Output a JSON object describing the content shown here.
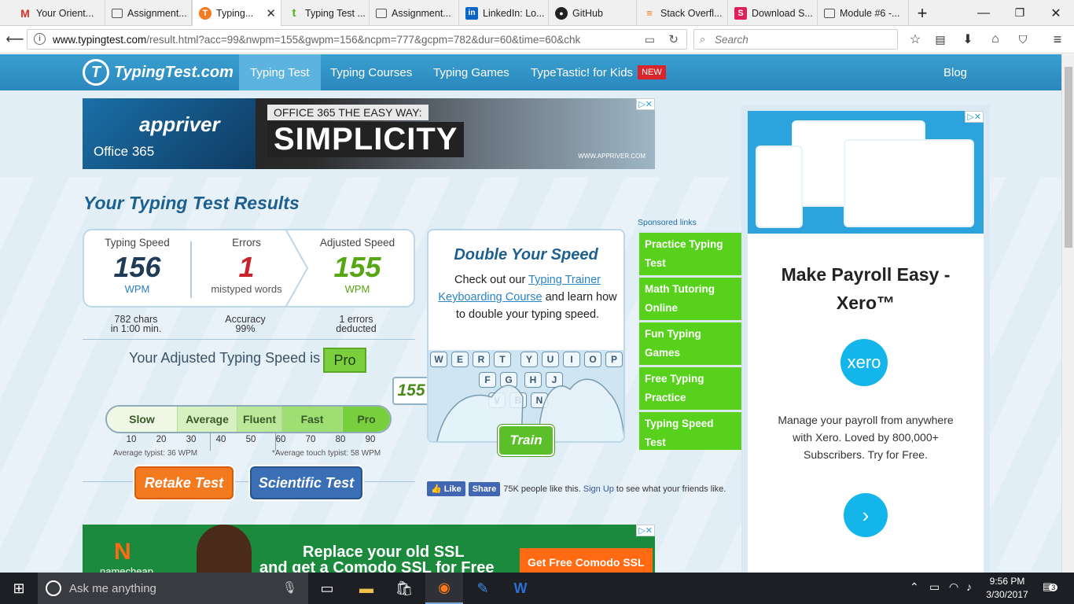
{
  "browser": {
    "tabs": [
      {
        "title": "Your Orient...",
        "icon": "gmail-icon",
        "active": false
      },
      {
        "title": "Assignment...",
        "icon": "book-icon",
        "active": false
      },
      {
        "title": "Typing...",
        "icon": "typingtest-icon",
        "active": true
      },
      {
        "title": "Typing Test ...",
        "icon": "t-icon",
        "active": false
      },
      {
        "title": "Assignment...",
        "icon": "book-icon",
        "active": false
      },
      {
        "title": "LinkedIn: Lo...",
        "icon": "linkedin-icon",
        "active": false
      },
      {
        "title": "GitHub",
        "icon": "github-icon",
        "active": false
      },
      {
        "title": "Stack Overfl...",
        "icon": "stackoverflow-icon",
        "active": false
      },
      {
        "title": "Download S...",
        "icon": "slack-icon",
        "active": false
      },
      {
        "title": "Module #6 -...",
        "icon": "book-icon",
        "active": false
      }
    ],
    "url_host": "www.typingtest.com",
    "url_rest": "/result.html?acc=99&nwpm=155&gwpm=156&ncpm=777&gcpm=782&dur=60&time=60&chk",
    "search_placeholder": "Search"
  },
  "site": {
    "logo": "TypingTest.com",
    "nav": [
      "Typing Test",
      "Typing Courses",
      "Typing Games",
      "TypeTastic! for Kids",
      "Blog"
    ],
    "nav_badge": "NEW"
  },
  "top_ad": {
    "brand": "appriver",
    "product": "Office 365",
    "tagline": "OFFICE 365 THE EASY WAY:",
    "headline": "SIMPLICITY",
    "url": "WWW.APPRIVER.COM"
  },
  "results": {
    "title": "Your Typing Test Results",
    "typing_speed": {
      "label": "Typing Speed",
      "value": "156",
      "unit": "WPM"
    },
    "errors": {
      "label": "Errors",
      "value": "1",
      "unit": "mistyped words"
    },
    "adjusted": {
      "label": "Adjusted Speed",
      "value": "155",
      "unit": "WPM"
    },
    "chars_line1": "782 chars",
    "chars_line2": "in 1:00 min.",
    "accuracy_label": "Accuracy",
    "accuracy_value": "99%",
    "deducted_line1": "1 errors",
    "deducted_line2": "deducted",
    "adjusted_level_text": "Your Adjusted Typing Speed is",
    "adjusted_level": "Pro",
    "scale_levels": [
      "Slow",
      "Average",
      "Fluent",
      "Fast",
      "Pro"
    ],
    "scale_ticks": [
      "10",
      "20",
      "30",
      "40",
      "50",
      "60",
      "70",
      "80",
      "90"
    ],
    "average_typist": "Average typist: 36 WPM",
    "touch_typist": "*Average touch typist: 58 WPM",
    "bubble_value": "155",
    "retake_label": "Retake Test",
    "scientific_label": "Scientific Test"
  },
  "double": {
    "title": "Double Your Speed",
    "text_prefix": "Check out our",
    "link1": "Typing Trainer",
    "link2": "Keyboarding Course",
    "text_suffix": "and learn how to double your typing speed.",
    "keys_row1": [
      "W",
      "E",
      "R",
      "T",
      "Y",
      "U",
      "I",
      "O",
      "P"
    ],
    "keys_row2": [
      "F",
      "G",
      "H",
      "J"
    ],
    "keys_row3": [
      "V",
      "B",
      "N"
    ],
    "train_label": "Train"
  },
  "facebook": {
    "like": "Like",
    "share": "Share",
    "count_text": "75K people like this.",
    "signup": "Sign Up",
    "suffix": "to see what your friends like."
  },
  "sponsored": {
    "label": "Sponsored links",
    "links": [
      "Practice Typing Test",
      "Math Tutoring Online",
      "Fun Typing Games",
      "Free Typing Practice",
      "Typing Speed Test"
    ]
  },
  "right_ad": {
    "title": "Make Payroll Easy - Xero™",
    "logo": "xero",
    "text": "Manage your payroll from anywhere with Xero. Loved by 800,000+ Subscribers. Try for Free."
  },
  "bottom_ad": {
    "brand": "namecheap",
    "line1": "Replace your old SSL",
    "line2": "and get a Comodo SSL for Free",
    "button": "Get Free Comodo SSL"
  },
  "taskbar": {
    "search_placeholder": "Ask me anything",
    "time": "9:56 PM",
    "date": "3/30/2017",
    "notifications": "3"
  }
}
